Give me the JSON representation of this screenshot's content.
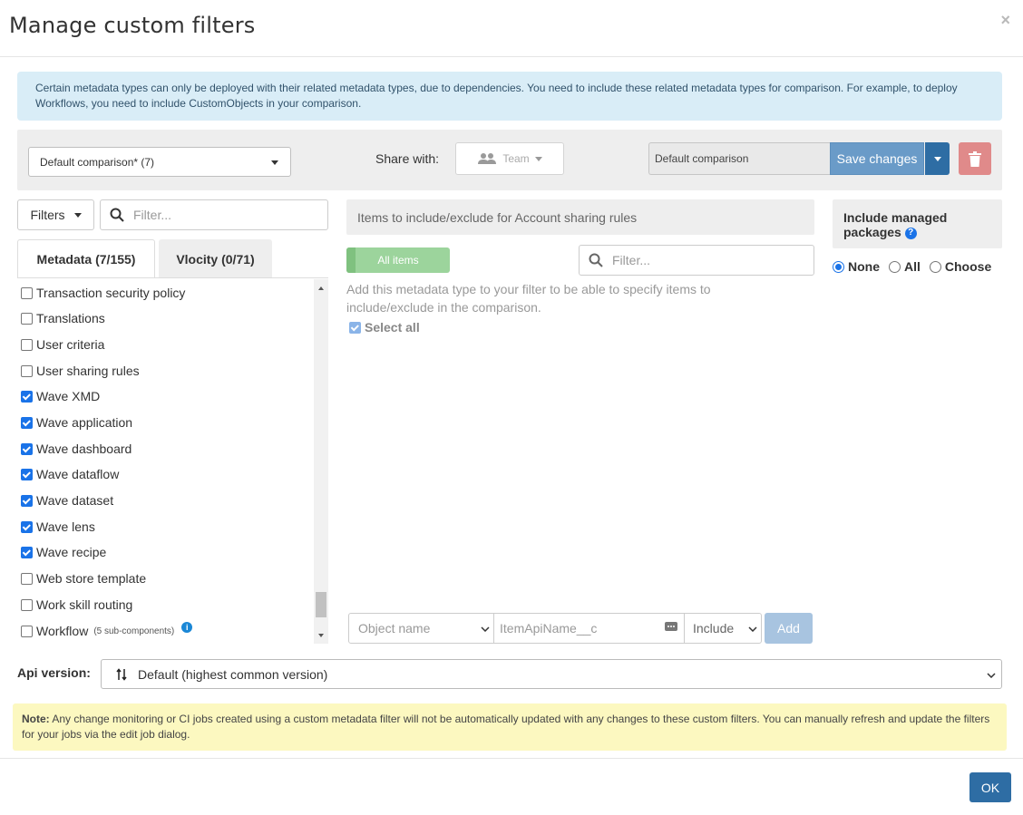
{
  "modal": {
    "title": "Manage custom filters",
    "close": "×"
  },
  "info": {
    "text": "Certain metadata types can only be deployed with their related metadata types, due to dependencies. You need to include these related metadata types for comparison. For example, to deploy Workflows, you need to include CustomObjects in your comparison."
  },
  "toolbar": {
    "comparison_select": "Default comparison* (7)",
    "share_label": "Share with:",
    "team_button": "Team",
    "name_value": "Default comparison",
    "save_label": "Save changes"
  },
  "left": {
    "filters_button": "Filters",
    "filter_placeholder": "Filter...",
    "tabs": [
      {
        "label": "Metadata (7/155)",
        "active": true
      },
      {
        "label": "Vlocity (0/71)",
        "active": false
      }
    ],
    "items": [
      {
        "label": "Transaction security policy",
        "checked": false
      },
      {
        "label": "Translations",
        "checked": false
      },
      {
        "label": "User criteria",
        "checked": false
      },
      {
        "label": "User sharing rules",
        "checked": false
      },
      {
        "label": "Wave XMD",
        "checked": true
      },
      {
        "label": "Wave application",
        "checked": true
      },
      {
        "label": "Wave dashboard",
        "checked": true
      },
      {
        "label": "Wave dataflow",
        "checked": true
      },
      {
        "label": "Wave dataset",
        "checked": true
      },
      {
        "label": "Wave lens",
        "checked": true
      },
      {
        "label": "Wave recipe",
        "checked": true
      },
      {
        "label": "Web store template",
        "checked": false
      },
      {
        "label": "Work skill routing",
        "checked": false
      },
      {
        "label": "Workflow",
        "checked": false,
        "note": "(5 sub-components)"
      }
    ]
  },
  "middle": {
    "header": "Items to include/exclude for Account sharing rules",
    "all_items_button": "All items",
    "filter_placeholder": "Filter...",
    "help_text": "Add this metadata type to your filter to be able to specify items to include/exclude in the comparison.",
    "select_all": "Select all",
    "object_name_placeholder": "Object name",
    "item_api_placeholder": "ItemApiName__c",
    "include_select": "Include",
    "add_button": "Add"
  },
  "right": {
    "managed_title": "Include managed packages",
    "help_icon": "?",
    "options": [
      {
        "label": "None",
        "selected": true
      },
      {
        "label": "All",
        "selected": false
      },
      {
        "label": "Choose",
        "selected": false
      }
    ]
  },
  "api": {
    "label": "Api version:",
    "value": "Default (highest common version)"
  },
  "note": {
    "bold": "Note:",
    "text": " Any change monitoring or CI jobs created using a custom metadata filter will not be automatically updated with any changes to these custom filters. You can manually refresh and update the filters for your jobs via the edit job dialog."
  },
  "footer": {
    "ok_button": "OK"
  },
  "colors": {
    "primary": "#2e6da4",
    "save": "#6a9bc8",
    "danger": "#e08a8a",
    "info_bg": "#d9edf7",
    "note_bg": "#fcf8c0",
    "all_items": "#9cd49c"
  }
}
